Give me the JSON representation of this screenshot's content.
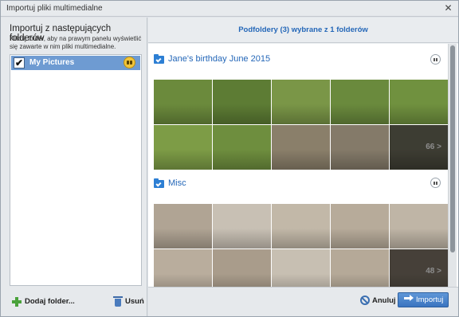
{
  "window": {
    "title": "Importuj pliki multimedialne",
    "close_glyph": "✕"
  },
  "left_panel": {
    "heading": "Importuj z następujących folderów",
    "instructions": "Kliknij folder, aby na prawym panelu wyświetlić się zawarte w nim pliki multimedialne.",
    "folders": [
      {
        "label": "My Pictures",
        "checked": true,
        "checkmark": "✔",
        "icon": "face-recognition-badge-icon"
      }
    ],
    "add_folder_label": "Dodaj folder...",
    "remove_label": "Usuń"
  },
  "right_panel": {
    "header": "Podfoldery (3) wybrane z 1 folderów",
    "sections": [
      {
        "title": "Jane's birthday June 2015",
        "more_label": "66 >",
        "rows": [
          [
            "#6b8a3c",
            "#5d7c34",
            "#7a9647",
            "#6a8a3d",
            "#70913f"
          ],
          [
            "#7d9c46",
            "#6e8e3e",
            "#8a7f6a",
            "#847a69",
            "#6f6e5c"
          ]
        ]
      },
      {
        "title": "Misc",
        "more_label": "48 >",
        "rows": [
          [
            "#b0a494",
            "#c8c0b4",
            "#c2b8a8",
            "#b7ab9a",
            "#bfb5a6"
          ],
          [
            "#b9ad9d",
            "#a99c8b",
            "#c7bfb2",
            "#b5a998",
            "#7f7568"
          ]
        ]
      }
    ],
    "cancel_label": "Anuluj",
    "import_label": "Importuj"
  }
}
